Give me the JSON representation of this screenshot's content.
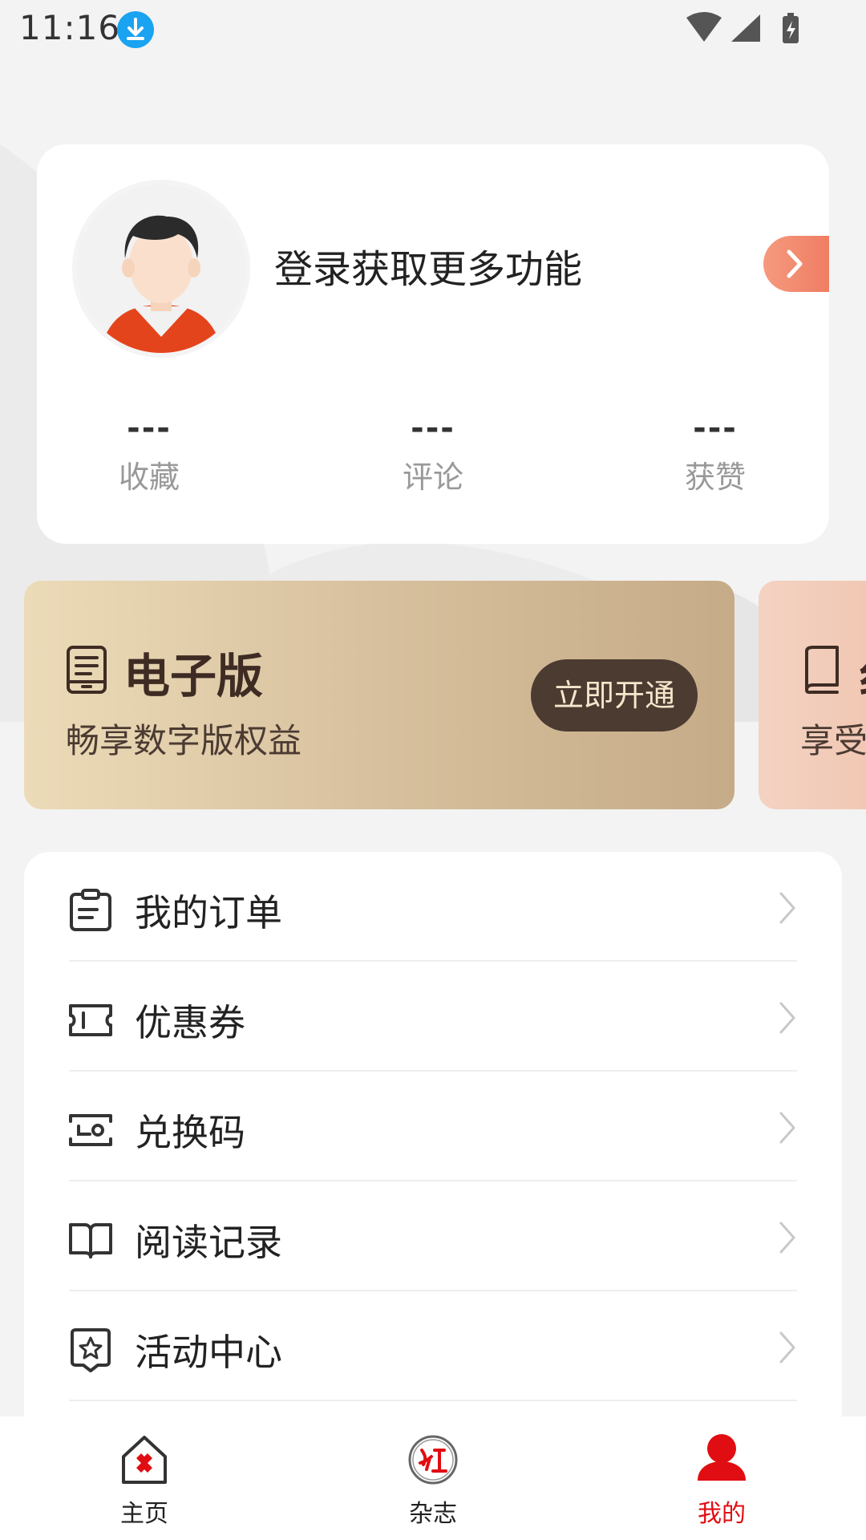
{
  "status_bar": {
    "time": "11:16"
  },
  "profile": {
    "login_prompt": "登录获取更多功能",
    "stats": [
      {
        "value": "---",
        "label": "收藏"
      },
      {
        "value": "---",
        "label": "评论"
      },
      {
        "value": "---",
        "label": "获赞"
      }
    ]
  },
  "vip": {
    "title": "电子版",
    "subtitle": "畅享数字版权益",
    "button": "立即开通",
    "second_title": "纟",
    "second_subtitle": "享受"
  },
  "menu": {
    "items": [
      {
        "label": "我的订单",
        "icon": "clipboard-icon"
      },
      {
        "label": "优惠券",
        "icon": "ticket-icon"
      },
      {
        "label": "兑换码",
        "icon": "redeem-icon"
      },
      {
        "label": "阅读记录",
        "icon": "open-book-icon"
      },
      {
        "label": "活动中心",
        "icon": "star-badge-icon"
      }
    ]
  },
  "nav": {
    "items": [
      {
        "label": "主页",
        "icon": "home-icon"
      },
      {
        "label": "杂志",
        "icon": "magazine-logo-icon"
      },
      {
        "label": "我的",
        "icon": "user-icon"
      }
    ],
    "active_color": "#e00d12"
  },
  "colors": {
    "accent": "#e00d12",
    "vip_button": "#4b3b31",
    "arrow": "#ef7d63"
  }
}
